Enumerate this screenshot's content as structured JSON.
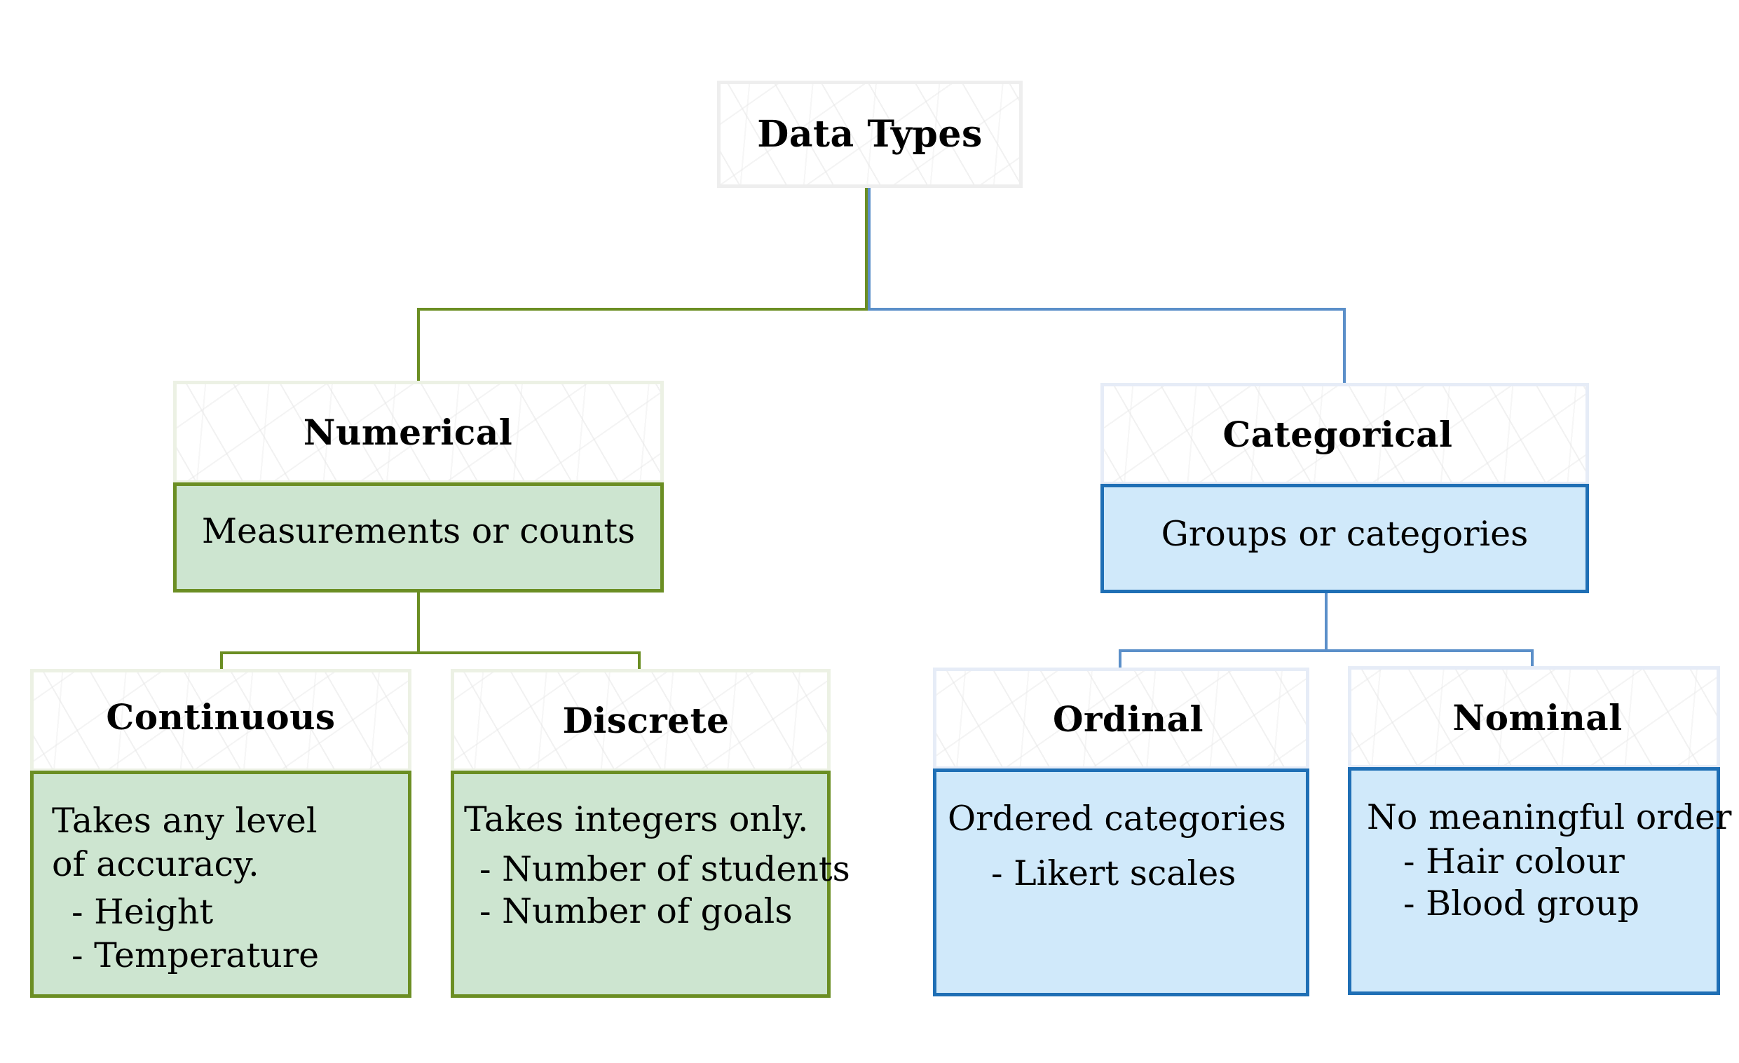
{
  "diagram": {
    "title": "Data Types",
    "colors": {
      "numerical_border": "#6b8e23",
      "numerical_fill": "#cde5d0",
      "categorical_border": "#1f6fb5",
      "categorical_fill": "#d0e9fa",
      "categorical_connector": "#5b8fc9"
    },
    "numerical": {
      "label": "Numerical",
      "description": "Measurements or counts",
      "children": [
        {
          "label": "Continuous",
          "description": "Takes any level of accuracy.",
          "examples": [
            "- Height",
            "- Temperature"
          ]
        },
        {
          "label": "Discrete",
          "description": "Takes integers only.",
          "examples": [
            "- Number of students",
            "- Number of goals"
          ]
        }
      ]
    },
    "categorical": {
      "label": "Categorical",
      "description": "Groups or categories",
      "children": [
        {
          "label": "Ordinal",
          "description": "Ordered categories",
          "examples": [
            "- Likert scales"
          ]
        },
        {
          "label": "Nominal",
          "description": "No meaningful order",
          "examples": [
            "- Hair colour",
            "- Blood group"
          ]
        }
      ]
    }
  }
}
